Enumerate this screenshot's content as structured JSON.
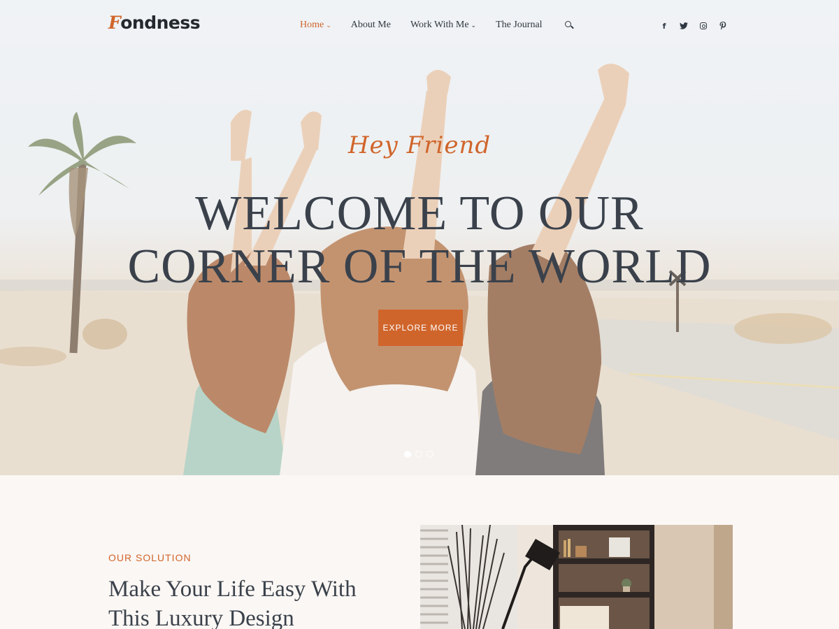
{
  "header": {
    "logo_initial": "F",
    "logo_rest": "ondness",
    "nav": [
      {
        "label": "Home",
        "dropdown": true,
        "active": true
      },
      {
        "label": "About Me",
        "dropdown": false,
        "active": false
      },
      {
        "label": "Work With Me",
        "dropdown": true,
        "active": false
      },
      {
        "label": "The Journal",
        "dropdown": false,
        "active": false
      }
    ],
    "social_icons": [
      "facebook-icon",
      "twitter-icon",
      "instagram-icon",
      "pinterest-icon"
    ]
  },
  "hero": {
    "script": "Hey Friend",
    "title": "WELCOME TO OUR CORNER OF THE WORLD",
    "button": "EXPLORE MORE",
    "slides": 3,
    "active_slide": 1
  },
  "solution": {
    "eyebrow": "OUR SOLUTION",
    "title": "Make Your Life Easy With This Luxury Design"
  },
  "colors": {
    "accent": "#d0652b",
    "text_dark": "#3a414b",
    "section_bg": "#fbf7f4"
  }
}
